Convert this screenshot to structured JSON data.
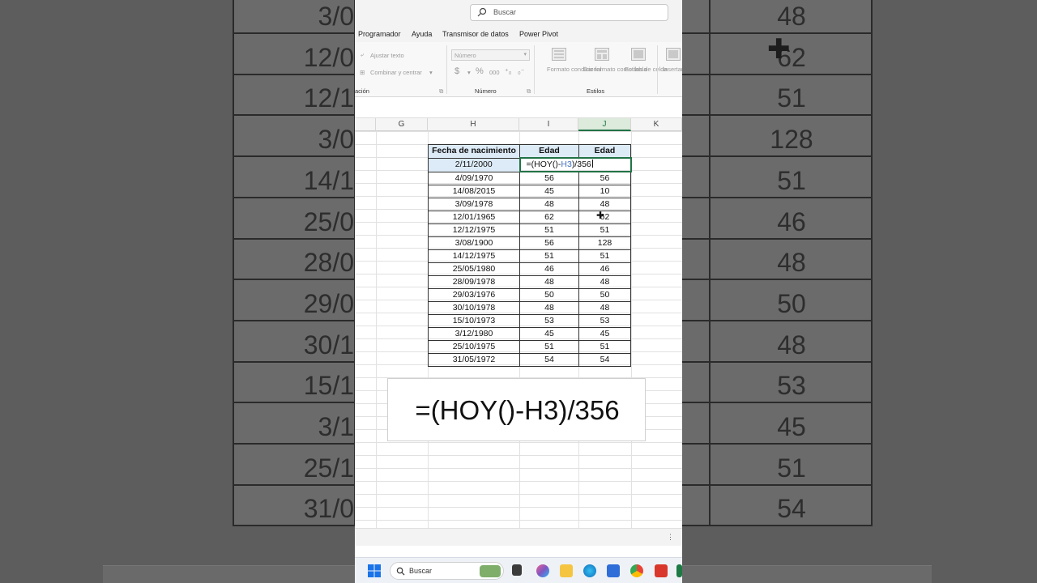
{
  "background": {
    "left_values": [
      "3/0",
      "12/0",
      "12/1",
      "3/0",
      "14/1",
      "25/0",
      "28/0",
      "29/0",
      "30/1",
      "15/1",
      "3/1",
      "25/1",
      "31/0"
    ],
    "right_values": [
      "48",
      "62",
      "51",
      "128",
      "51",
      "46",
      "48",
      "50",
      "48",
      "53",
      "45",
      "51",
      "54"
    ]
  },
  "search": {
    "placeholder": "Buscar"
  },
  "menu_tabs": [
    "Programador",
    "Ayuda",
    "Transmisor de datos",
    "Power Pivot"
  ],
  "ribbon": {
    "wrap_text": "Ajustar texto",
    "merge_center": "Combinar y centrar",
    "alignment_group": "ación",
    "number_format": "Número",
    "currency": "$",
    "percent": "%",
    "thousands": "000",
    "number_group": "Número",
    "conditional_format": "Formato condicional",
    "format_as_table": "Dar formato como tabla",
    "cell_styles": "Estilos de celda",
    "insert": "Insertar",
    "styles_group": "Estilos"
  },
  "columns": [
    "G",
    "H",
    "I",
    "J",
    "K"
  ],
  "table": {
    "headers": [
      "Fecha de nacimiento",
      "Edad",
      "Edad"
    ],
    "active_formula": {
      "open": "=(HOY()-",
      "ref": "H3",
      "close": ")/356"
    },
    "active_date": "2/11/2000",
    "rows": [
      [
        "4/09/1970",
        "56",
        "56"
      ],
      [
        "14/08/2015",
        "45",
        "10"
      ],
      [
        "3/09/1978",
        "48",
        "48"
      ],
      [
        "12/01/1965",
        "62",
        "62"
      ],
      [
        "12/12/1975",
        "51",
        "51"
      ],
      [
        "3/08/1900",
        "56",
        "128"
      ],
      [
        "14/12/1975",
        "51",
        "51"
      ],
      [
        "25/05/1980",
        "46",
        "46"
      ],
      [
        "28/09/1978",
        "48",
        "48"
      ],
      [
        "29/03/1976",
        "50",
        "50"
      ],
      [
        "30/10/1978",
        "48",
        "48"
      ],
      [
        "15/10/1973",
        "53",
        "53"
      ],
      [
        "3/12/1980",
        "45",
        "45"
      ],
      [
        "25/10/1975",
        "51",
        "51"
      ],
      [
        "31/05/1972",
        "54",
        "54"
      ]
    ]
  },
  "callout": {
    "formula": "=(HOY()-H3)/356"
  },
  "taskbar": {
    "search_label": "Buscar"
  },
  "colors": {
    "excel_green": "#217346",
    "header_fill": "#ddebf7",
    "reference_blue": "#4472c4"
  }
}
